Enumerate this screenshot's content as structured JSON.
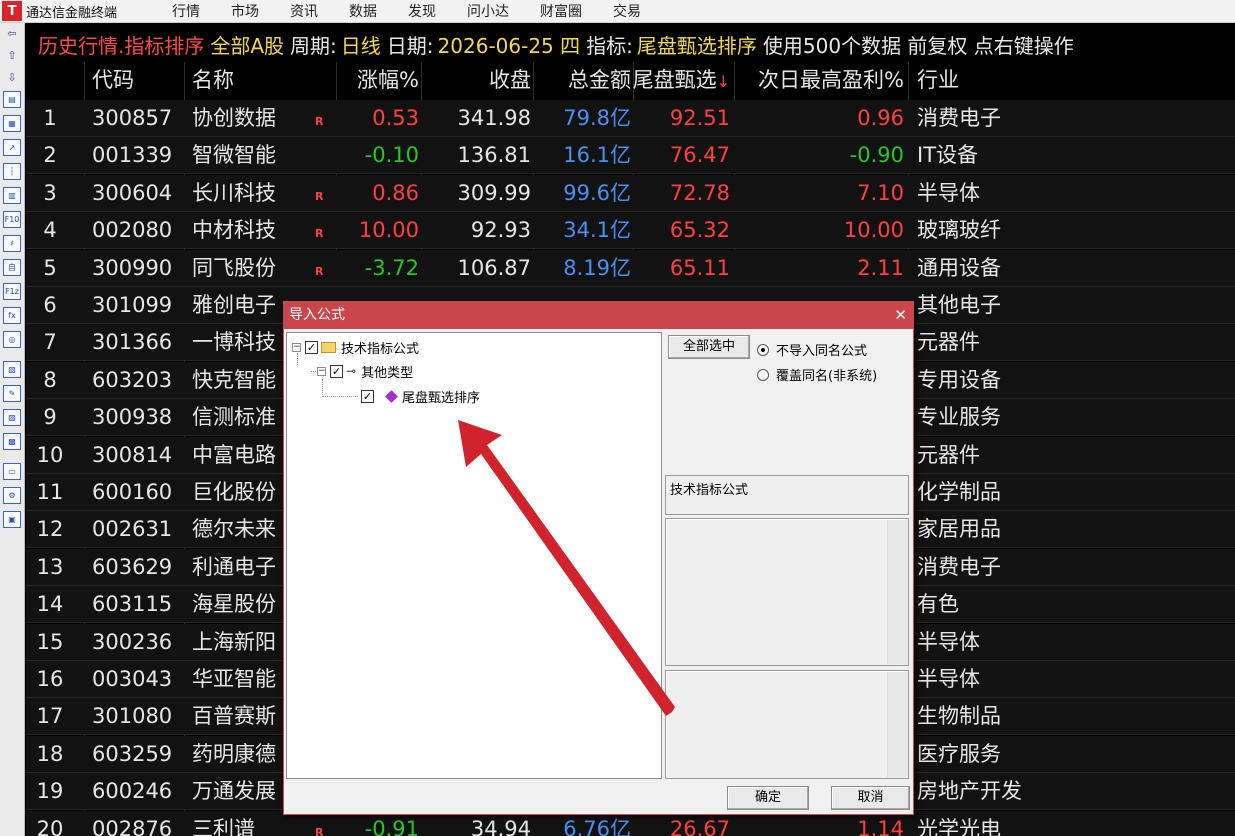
{
  "app": {
    "logo": "T",
    "title": "通达信金融终端"
  },
  "menu": [
    "行情",
    "市场",
    "资讯",
    "数据",
    "发现",
    "问小达",
    "财富圈",
    "交易"
  ],
  "left_toolbar": [
    {
      "icon": "arrow-left-icon",
      "glyph": "⇦"
    },
    {
      "icon": "arrow-up-icon",
      "glyph": "⇧"
    },
    {
      "icon": "arrow-down-icon",
      "glyph": "⇩"
    },
    {
      "icon": "quote-list-icon",
      "glyph": "▤"
    },
    {
      "icon": "grid-icon",
      "glyph": "▦"
    },
    {
      "icon": "trend-chart-icon",
      "glyph": "↗"
    },
    {
      "icon": "candle-chart-icon",
      "glyph": "┆"
    },
    {
      "icon": "report-icon",
      "glyph": "▥"
    },
    {
      "icon": "f10-icon",
      "glyph": "F10"
    },
    {
      "icon": "tree-icon",
      "glyph": "♯"
    },
    {
      "icon": "self-select-icon",
      "glyph": "自"
    },
    {
      "icon": "f1z-icon",
      "glyph": "F1z"
    },
    {
      "icon": "formula-icon",
      "glyph": "fx"
    },
    {
      "icon": "target-icon",
      "glyph": "◎"
    },
    {
      "icon": "news-icon",
      "glyph": "▧"
    },
    {
      "icon": "edit-icon",
      "glyph": "✎"
    },
    {
      "icon": "doc-icon",
      "glyph": "▨"
    },
    {
      "icon": "doc2-icon",
      "glyph": "▩"
    },
    {
      "icon": "folder-icon",
      "glyph": "▭"
    },
    {
      "icon": "tools-icon",
      "glyph": "⚙"
    },
    {
      "icon": "calc-icon",
      "glyph": "▣"
    }
  ],
  "infobar": {
    "mode": "历史行情.指标排序",
    "scope": "全部A股",
    "period_label": "周期:",
    "period": "日线",
    "date_label": "日期:",
    "date": "2026-06-25 四",
    "indicator_label": "指标:",
    "indicator": "尾盘甄选排序",
    "note": "使用500个数据 前复权 点右键操作"
  },
  "columns": {
    "code": "代码",
    "name": "名称",
    "pct": "涨幅%",
    "close": "收盘",
    "amount": "总金额",
    "score": "尾盘甄选",
    "sort_arrow": "↓",
    "profit": "次日最高盈利%",
    "industry": "行业"
  },
  "rows": [
    {
      "idx": "1",
      "code": "300857",
      "name": "协创数据",
      "r": "R",
      "pct": "0.53",
      "pct_dir": "up",
      "close": "341.98",
      "amount": "79.8亿",
      "score": "92.51",
      "profit": "0.96",
      "profit_dir": "up",
      "industry": "消费电子"
    },
    {
      "idx": "2",
      "code": "001339",
      "name": "智微智能",
      "r": "",
      "pct": "-0.10",
      "pct_dir": "down",
      "close": "136.81",
      "amount": "16.1亿",
      "score": "76.47",
      "profit": "-0.90",
      "profit_dir": "down",
      "industry": "IT设备"
    },
    {
      "idx": "3",
      "code": "300604",
      "name": "长川科技",
      "r": "R",
      "pct": "0.86",
      "pct_dir": "up",
      "close": "309.99",
      "amount": "99.6亿",
      "score": "72.78",
      "profit": "7.10",
      "profit_dir": "up",
      "industry": "半导体"
    },
    {
      "idx": "4",
      "code": "002080",
      "name": "中材科技",
      "r": "R",
      "pct": "10.00",
      "pct_dir": "up",
      "close": "92.93",
      "amount": "34.1亿",
      "score": "65.32",
      "profit": "10.00",
      "profit_dir": "up",
      "industry": "玻璃玻纤"
    },
    {
      "idx": "5",
      "code": "300990",
      "name": "同飞股份",
      "r": "R",
      "pct": "-3.72",
      "pct_dir": "down",
      "close": "106.87",
      "amount": "8.19亿",
      "score": "65.11",
      "profit": "2.11",
      "profit_dir": "up",
      "industry": "通用设备"
    },
    {
      "idx": "6",
      "code": "301099",
      "name": "雅创电子",
      "r": "",
      "pct": "",
      "pct_dir": "",
      "close": "",
      "amount": "",
      "score": "",
      "profit": "",
      "profit_dir": "",
      "industry": "其他电子"
    },
    {
      "idx": "7",
      "code": "301366",
      "name": "一博科技",
      "r": "",
      "pct": "",
      "pct_dir": "",
      "close": "",
      "amount": "",
      "score": "",
      "profit": "",
      "profit_dir": "",
      "industry": "元器件"
    },
    {
      "idx": "8",
      "code": "603203",
      "name": "快克智能",
      "r": "",
      "pct": "",
      "pct_dir": "",
      "close": "",
      "amount": "",
      "score": "",
      "profit": "",
      "profit_dir": "",
      "industry": "专用设备"
    },
    {
      "idx": "9",
      "code": "300938",
      "name": "信测标准",
      "r": "",
      "pct": "",
      "pct_dir": "",
      "close": "",
      "amount": "",
      "score": "",
      "profit": "",
      "profit_dir": "",
      "industry": "专业服务"
    },
    {
      "idx": "10",
      "code": "300814",
      "name": "中富电路",
      "r": "",
      "pct": "",
      "pct_dir": "",
      "close": "",
      "amount": "",
      "score": "",
      "profit": "",
      "profit_dir": "",
      "industry": "元器件"
    },
    {
      "idx": "11",
      "code": "600160",
      "name": "巨化股份",
      "r": "",
      "pct": "",
      "pct_dir": "",
      "close": "",
      "amount": "",
      "score": "",
      "profit": "",
      "profit_dir": "",
      "industry": "化学制品"
    },
    {
      "idx": "12",
      "code": "002631",
      "name": "德尔未来",
      "r": "",
      "pct": "",
      "pct_dir": "",
      "close": "",
      "amount": "",
      "score": "",
      "profit": "",
      "profit_dir": "",
      "industry": "家居用品"
    },
    {
      "idx": "13",
      "code": "603629",
      "name": "利通电子",
      "r": "",
      "pct": "",
      "pct_dir": "",
      "close": "",
      "amount": "",
      "score": "",
      "profit": "",
      "profit_dir": "",
      "industry": "消费电子"
    },
    {
      "idx": "14",
      "code": "603115",
      "name": "海星股份",
      "r": "",
      "pct": "",
      "pct_dir": "",
      "close": "",
      "amount": "",
      "score": "",
      "profit": "",
      "profit_dir": "",
      "industry": "有色"
    },
    {
      "idx": "15",
      "code": "300236",
      "name": "上海新阳",
      "r": "",
      "pct": "",
      "pct_dir": "",
      "close": "",
      "amount": "",
      "score": "",
      "profit": "",
      "profit_dir": "",
      "industry": "半导体"
    },
    {
      "idx": "16",
      "code": "003043",
      "name": "华亚智能",
      "r": "",
      "pct": "",
      "pct_dir": "",
      "close": "",
      "amount": "",
      "score": "",
      "profit": "",
      "profit_dir": "",
      "industry": "半导体"
    },
    {
      "idx": "17",
      "code": "301080",
      "name": "百普赛斯",
      "r": "",
      "pct": "",
      "pct_dir": "",
      "close": "",
      "amount": "",
      "score": "",
      "profit": "",
      "profit_dir": "",
      "industry": "生物制品"
    },
    {
      "idx": "18",
      "code": "603259",
      "name": "药明康德",
      "r": "",
      "pct": "",
      "pct_dir": "",
      "close": "",
      "amount": "",
      "score": "",
      "profit": "",
      "profit_dir": "",
      "industry": "医疗服务"
    },
    {
      "idx": "19",
      "code": "600246",
      "name": "万通发展",
      "r": "",
      "pct": "",
      "pct_dir": "",
      "close": "",
      "amount": "",
      "score": "",
      "profit": "",
      "profit_dir": "",
      "industry": "房地产开发"
    },
    {
      "idx": "20",
      "code": "002876",
      "name": "三利谱",
      "r": "R",
      "pct": "-0.91",
      "pct_dir": "down",
      "close": "34.94",
      "amount": "6.76亿",
      "score": "26.67",
      "profit": "1.14",
      "profit_dir": "up",
      "industry": "光学光电"
    }
  ],
  "dialog": {
    "title": "导入公式",
    "close_glyph": "✕",
    "tree": {
      "root": "技术指标公式",
      "child": "其他类型",
      "leaf": "尾盘甄选排序",
      "check_glyph": "✓",
      "expander_glyph": "−",
      "key_glyph": "⊸"
    },
    "select_all": "全部选中",
    "radio_no_import": "不导入同名公式",
    "radio_overwrite": "覆盖同名(非系统)",
    "info_label": "技术指标公式",
    "ok": "确定",
    "cancel": "取消"
  },
  "colors": {
    "up": "#ff4040",
    "down": "#26c826",
    "amount": "#4a90f0",
    "dialog_title": "#c9474c",
    "arrow": "#d0232e"
  }
}
